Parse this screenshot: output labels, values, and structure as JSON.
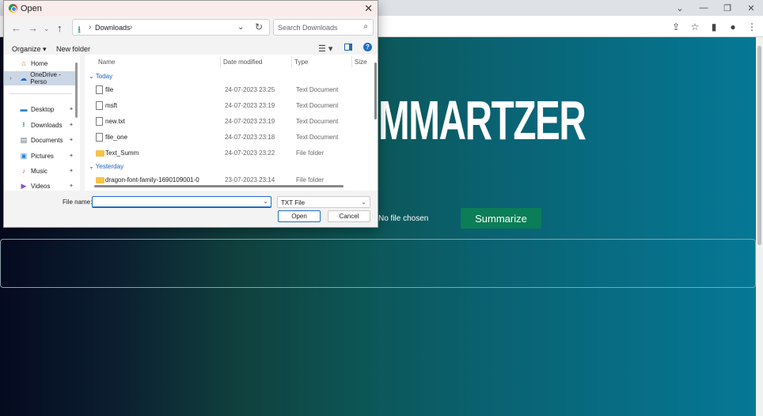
{
  "browser": {
    "win_controls": {
      "minimize": "⌄",
      "restore": "—",
      "maximize": "❐",
      "close": "✕"
    },
    "toolbar_icons": [
      "share-icon",
      "star-icon",
      "sidepanel-icon",
      "profile-icon",
      "menu-icon"
    ]
  },
  "page": {
    "title": "MMARTZER",
    "no_file_text": "No file chosen",
    "summarize_label": "Summarize",
    "accent_color": "#0b7d57"
  },
  "dialog": {
    "title": "Open",
    "address": {
      "folder": "Downloads"
    },
    "search_placeholder": "Search Downloads",
    "commands": {
      "organize": "Organize ▾",
      "new_folder": "New folder"
    },
    "nav_items": [
      {
        "label": "Home",
        "icon": "home-icon"
      },
      {
        "label": "OneDrive - Perso",
        "icon": "cloud-icon"
      },
      {
        "label": "Desktop",
        "icon": "desktop-icon"
      },
      {
        "label": "Downloads",
        "icon": "download-icon"
      },
      {
        "label": "Documents",
        "icon": "documents-icon"
      },
      {
        "label": "Pictures",
        "icon": "pictures-icon"
      },
      {
        "label": "Music",
        "icon": "music-icon"
      },
      {
        "label": "Videos",
        "icon": "videos-icon"
      }
    ],
    "columns": {
      "name": "Name",
      "date": "Date modified",
      "type": "Type",
      "size": "Size"
    },
    "groups": {
      "today": "Today",
      "yesterday": "Yesterday"
    },
    "files": [
      {
        "name": "file",
        "date": "24-07-2023 23:25",
        "type": "Text Document"
      },
      {
        "name": "msft",
        "date": "24-07-2023 23:19",
        "type": "Text Document"
      },
      {
        "name": "new.txt",
        "date": "24-07-2023 23:19",
        "type": "Text Document"
      },
      {
        "name": "file_one",
        "date": "24-07-2023 23:18",
        "type": "Text Document"
      },
      {
        "name": "Text_Summ",
        "date": "24-07-2023 23:22",
        "type": "File folder"
      },
      {
        "name": "dragon-font-family-1690109001-0",
        "date": "23-07-2023 23:14",
        "type": "File folder"
      }
    ],
    "file_name_label": "File name:",
    "file_name_value": "",
    "file_type": "TXT File",
    "open_label": "Open",
    "cancel_label": "Cancel"
  }
}
